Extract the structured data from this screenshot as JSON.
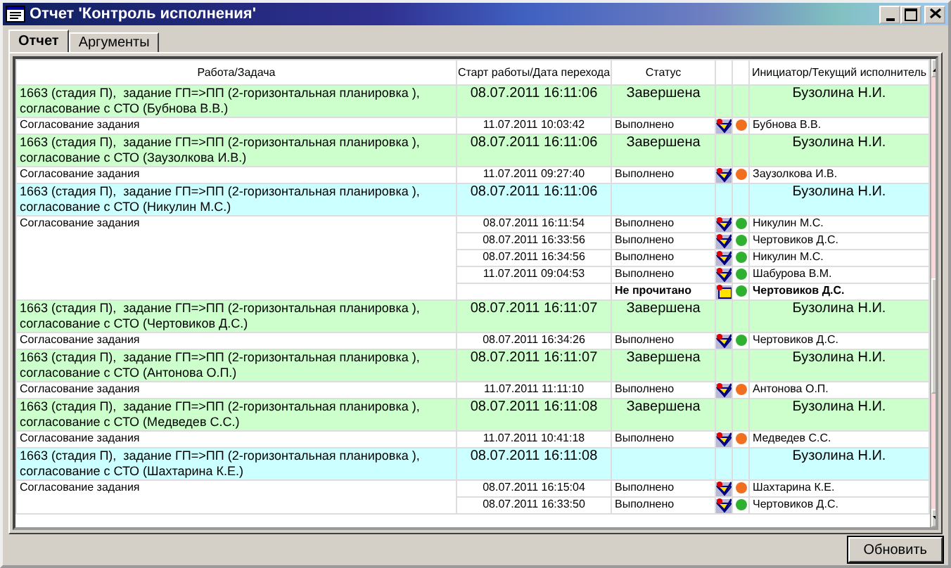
{
  "window": {
    "title": "Отчет 'Контроль исполнения'"
  },
  "tabs": [
    {
      "label": "Отчет",
      "selected": true
    },
    {
      "label": "Аргументы",
      "selected": false
    }
  ],
  "table": {
    "columns": {
      "task": "Работа/Задача",
      "start": "Старт работы/Дата перехода",
      "status": "Статус",
      "initiator": "Инициатор/Текущий исполнитель"
    },
    "groups": [
      {
        "task": "1663 (стадия П),  задание ГП=>ПП (2-горизонтальная планировка ),\nсогласование с СТО (Бубнова В.В.)",
        "start": "08.07.2011 16:11:06",
        "status": "Завершена",
        "initiator": "Бузолина Н.И.",
        "color": "#ccffcc",
        "subtask": "Согласование задания",
        "steps": [
          {
            "date": "11.07.2011 10:03:42",
            "status": "Выполнено",
            "person": "Бубнова В.В.",
            "kind": "done",
            "color": "#f07020"
          }
        ]
      },
      {
        "task": "1663 (стадия П),  задание ГП=>ПП (2-горизонтальная планировка ),\nсогласование с СТО (Заузолкова И.В.)",
        "start": "08.07.2011 16:11:06",
        "status": "Завершена",
        "initiator": "Бузолина Н.И.",
        "color": "#ccffcc",
        "subtask": "Согласование задания",
        "steps": [
          {
            "date": "11.07.2011 09:27:40",
            "status": "Выполнено",
            "person": "Заузолкова И.В.",
            "kind": "done",
            "color": "#f07020"
          }
        ]
      },
      {
        "task": "1663 (стадия П),  задание ГП=>ПП (2-горизонтальная планировка ),\nсогласование с СТО (Никулин М.С.)",
        "start": "08.07.2011 16:11:06",
        "initiator": "Бузолина Н.И.",
        "color": "#ccffff",
        "subtask": "Согласование задания",
        "steps": [
          {
            "date": "08.07.2011 16:11:54",
            "status": "Выполнено",
            "person": "Никулин М.С.",
            "kind": "done",
            "color": "#30b030"
          },
          {
            "date": "08.07.2011 16:33:56",
            "status": "Выполнено",
            "person": "Чертовиков Д.С.",
            "kind": "done",
            "color": "#30b030"
          },
          {
            "date": "08.07.2011 16:34:56",
            "status": "Выполнено",
            "person": "Никулин М.С.",
            "kind": "done",
            "color": "#30b030"
          },
          {
            "date": "11.07.2011 09:04:53",
            "status": "Выполнено",
            "person": "Шабурова В.М.",
            "kind": "done",
            "color": "#30b030"
          },
          {
            "status": "Не прочитано",
            "person": "Чертовиков Д.С.",
            "kind": "unread",
            "color": "#30b030"
          }
        ]
      },
      {
        "task": "1663 (стадия П),  задание ГП=>ПП (2-горизонтальная планировка ),\nсогласование с СТО (Чертовиков Д.С.)",
        "start": "08.07.2011 16:11:07",
        "status": "Завершена",
        "initiator": "Бузолина Н.И.",
        "color": "#ccffcc",
        "subtask": "Согласование задания",
        "steps": [
          {
            "date": "08.07.2011 16:34:26",
            "status": "Выполнено",
            "person": "Чертовиков Д.С.",
            "kind": "done",
            "color": "#30b030"
          }
        ]
      },
      {
        "task": "1663 (стадия П),  задание ГП=>ПП (2-горизонтальная планировка ),\nсогласование с СТО (Антонова О.П.)",
        "start": "08.07.2011 16:11:07",
        "status": "Завершена",
        "initiator": "Бузолина Н.И.",
        "color": "#ccffcc",
        "subtask": "Согласование задания",
        "steps": [
          {
            "date": "11.07.2011 11:11:10",
            "status": "Выполнено",
            "person": "Антонова О.П.",
            "kind": "done",
            "color": "#f07020"
          }
        ]
      },
      {
        "task": "1663 (стадия П),  задание ГП=>ПП (2-горизонтальная планировка ),\nсогласование с СТО (Медведев С.С.)",
        "start": "08.07.2011 16:11:08",
        "status": "Завершена",
        "initiator": "Бузолина Н.И.",
        "color": "#ccffcc",
        "subtask": "Согласование задания",
        "steps": [
          {
            "date": "11.07.2011 10:41:18",
            "status": "Выполнено",
            "person": "Медведев С.С.",
            "kind": "done",
            "color": "#f07020"
          }
        ]
      },
      {
        "task": "1663 (стадия П),  задание ГП=>ПП (2-горизонтальная планировка ),\nсогласование с СТО (Шахтарина К.Е.)",
        "start": "08.07.2011 16:11:08",
        "initiator": "Бузолина Н.И.",
        "color": "#ccffff",
        "subtask": "Согласование задания",
        "steps": [
          {
            "date": "08.07.2011 16:15:04",
            "status": "Выполнено",
            "person": "Шахтарина К.Е.",
            "kind": "done",
            "color": "#f07020"
          },
          {
            "date": "08.07.2011 16:33:50",
            "status": "Выполнено",
            "person": "Чертовиков Д.С.",
            "kind": "done",
            "color": "#30b030"
          }
        ]
      }
    ]
  },
  "buttons": [
    {
      "label": "Обновить"
    }
  ]
}
